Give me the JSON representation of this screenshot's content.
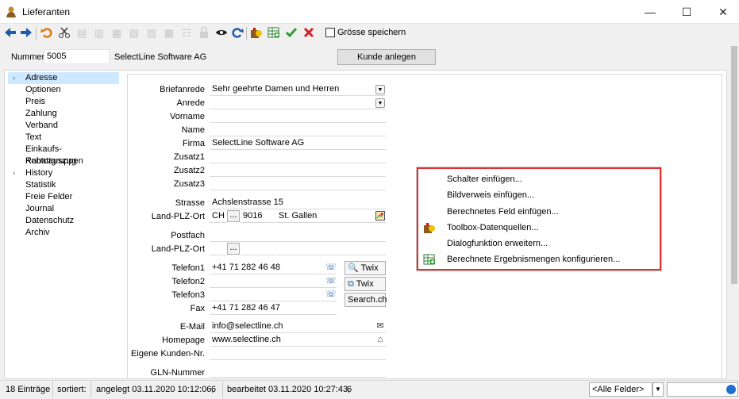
{
  "window": {
    "title": "Lieferanten",
    "minimize_glyph": "—",
    "maximize_glyph": "☐",
    "close_glyph": "✕"
  },
  "toolbar": {
    "icons": [
      "arrow-left-icon",
      "arrow-right-icon",
      "undo-icon",
      "cut-icon",
      "align-left-icon",
      "align-top-icon",
      "align-bottom-icon",
      "align-right-icon",
      "align-center-h-icon",
      "align-center-v-icon",
      "distribute-icon",
      "lock-icon",
      "eye-icon",
      "refresh-icon",
      "toolbox-icon",
      "table-add-icon",
      "check-icon",
      "cancel-icon"
    ],
    "groesse_label": "Grösse speichern"
  },
  "header": {
    "nummer_label": "Nummer",
    "nummer_value": "5005",
    "firma": "SelectLine Software AG",
    "kunde_button": "Kunde anlegen"
  },
  "nav": {
    "items": [
      {
        "label": "Adresse",
        "chevron": "›"
      },
      {
        "label": "Optionen"
      },
      {
        "label": "Preis"
      },
      {
        "label": "Zahlung"
      },
      {
        "label": "Verband"
      },
      {
        "label": "Text"
      },
      {
        "label": "Einkaufs-Rabattgruppen"
      },
      {
        "label": "Kontoauszug"
      },
      {
        "label": "History",
        "chevron": "›"
      },
      {
        "label": "Statistik"
      },
      {
        "label": "Freie Felder"
      },
      {
        "label": "Journal"
      },
      {
        "label": "Datenschutz"
      },
      {
        "label": "Archiv"
      }
    ]
  },
  "form": {
    "briefanrede_label": "Briefanrede",
    "briefanrede_value": "Sehr geehrte Damen und Herren",
    "anrede_label": "Anrede",
    "anrede_value": "",
    "vorname_label": "Vorname",
    "vorname_value": "",
    "name_label": "Name",
    "name_value": "",
    "firma_label": "Firma",
    "firma_value": "SelectLine Software AG",
    "zusatz1_label": "Zusatz1",
    "zusatz2_label": "Zusatz2",
    "zusatz3_label": "Zusatz3",
    "strasse_label": "Strasse",
    "strasse_value": "Achslenstrasse 15",
    "land_plz_ort_label": "Land-PLZ-Ort",
    "land_value": "CH",
    "plz_value": "9016",
    "ort_value": "St. Gallen",
    "dots": "...",
    "postfach_label": "Postfach",
    "postfach_value": "",
    "land_plz_ort2_label": "Land-PLZ-Ort",
    "telefon1_label": "Telefon1",
    "telefon1_value": "+41 71 282 46 48",
    "telefon2_label": "Telefon2",
    "telefon2_value": "",
    "telefon3_label": "Telefon3",
    "telefon3_value": "",
    "fax_label": "Fax",
    "fax_value": "+41 71 282 46 47",
    "email_label": "E-Mail",
    "email_value": "info@selectline.ch",
    "homepage_label": "Homepage",
    "homepage_value": "www.selectline.ch",
    "eigene_kunden_nr_label": "Eigene Kunden-Nr.",
    "eigene_kunden_nr_value": "",
    "gln_label": "GLN-Nummer",
    "gln_value": "",
    "twix1_label": "Twix",
    "twix2_label": "Twix",
    "searchch_label": "Search.ch"
  },
  "context_menu": {
    "items": [
      {
        "label": "Schalter einfügen..."
      },
      {
        "label": "Bildverweis einfügen..."
      },
      {
        "label": "Berechnetes Feld einfügen..."
      },
      {
        "label": "Toolbox-Datenquellen...",
        "icon": "toolbox-icon"
      },
      {
        "label": "Dialogfunktion erweitern..."
      },
      {
        "label": "Berechnete Ergebnismengen konfigurieren...",
        "icon": "table-add-icon"
      }
    ]
  },
  "status": {
    "count": "18 Einträge",
    "sortiert": "sortiert:",
    "angelegt": "angelegt 03.11.2020 10:12:06,",
    "angelegt_user": "6",
    "bearbeitet": "bearbeitet 03.11.2020 10:27:43,",
    "bearbeitet_user": "6",
    "felder_select": "<Alle Felder>",
    "dropdown_glyph": "▼"
  },
  "colors": {
    "accent_blue": "#1f5aa8",
    "selection": "#cde8ff",
    "menu_highlight_border": "#e03030",
    "check_green": "#2e9e2e",
    "cancel_red": "#d42020"
  }
}
